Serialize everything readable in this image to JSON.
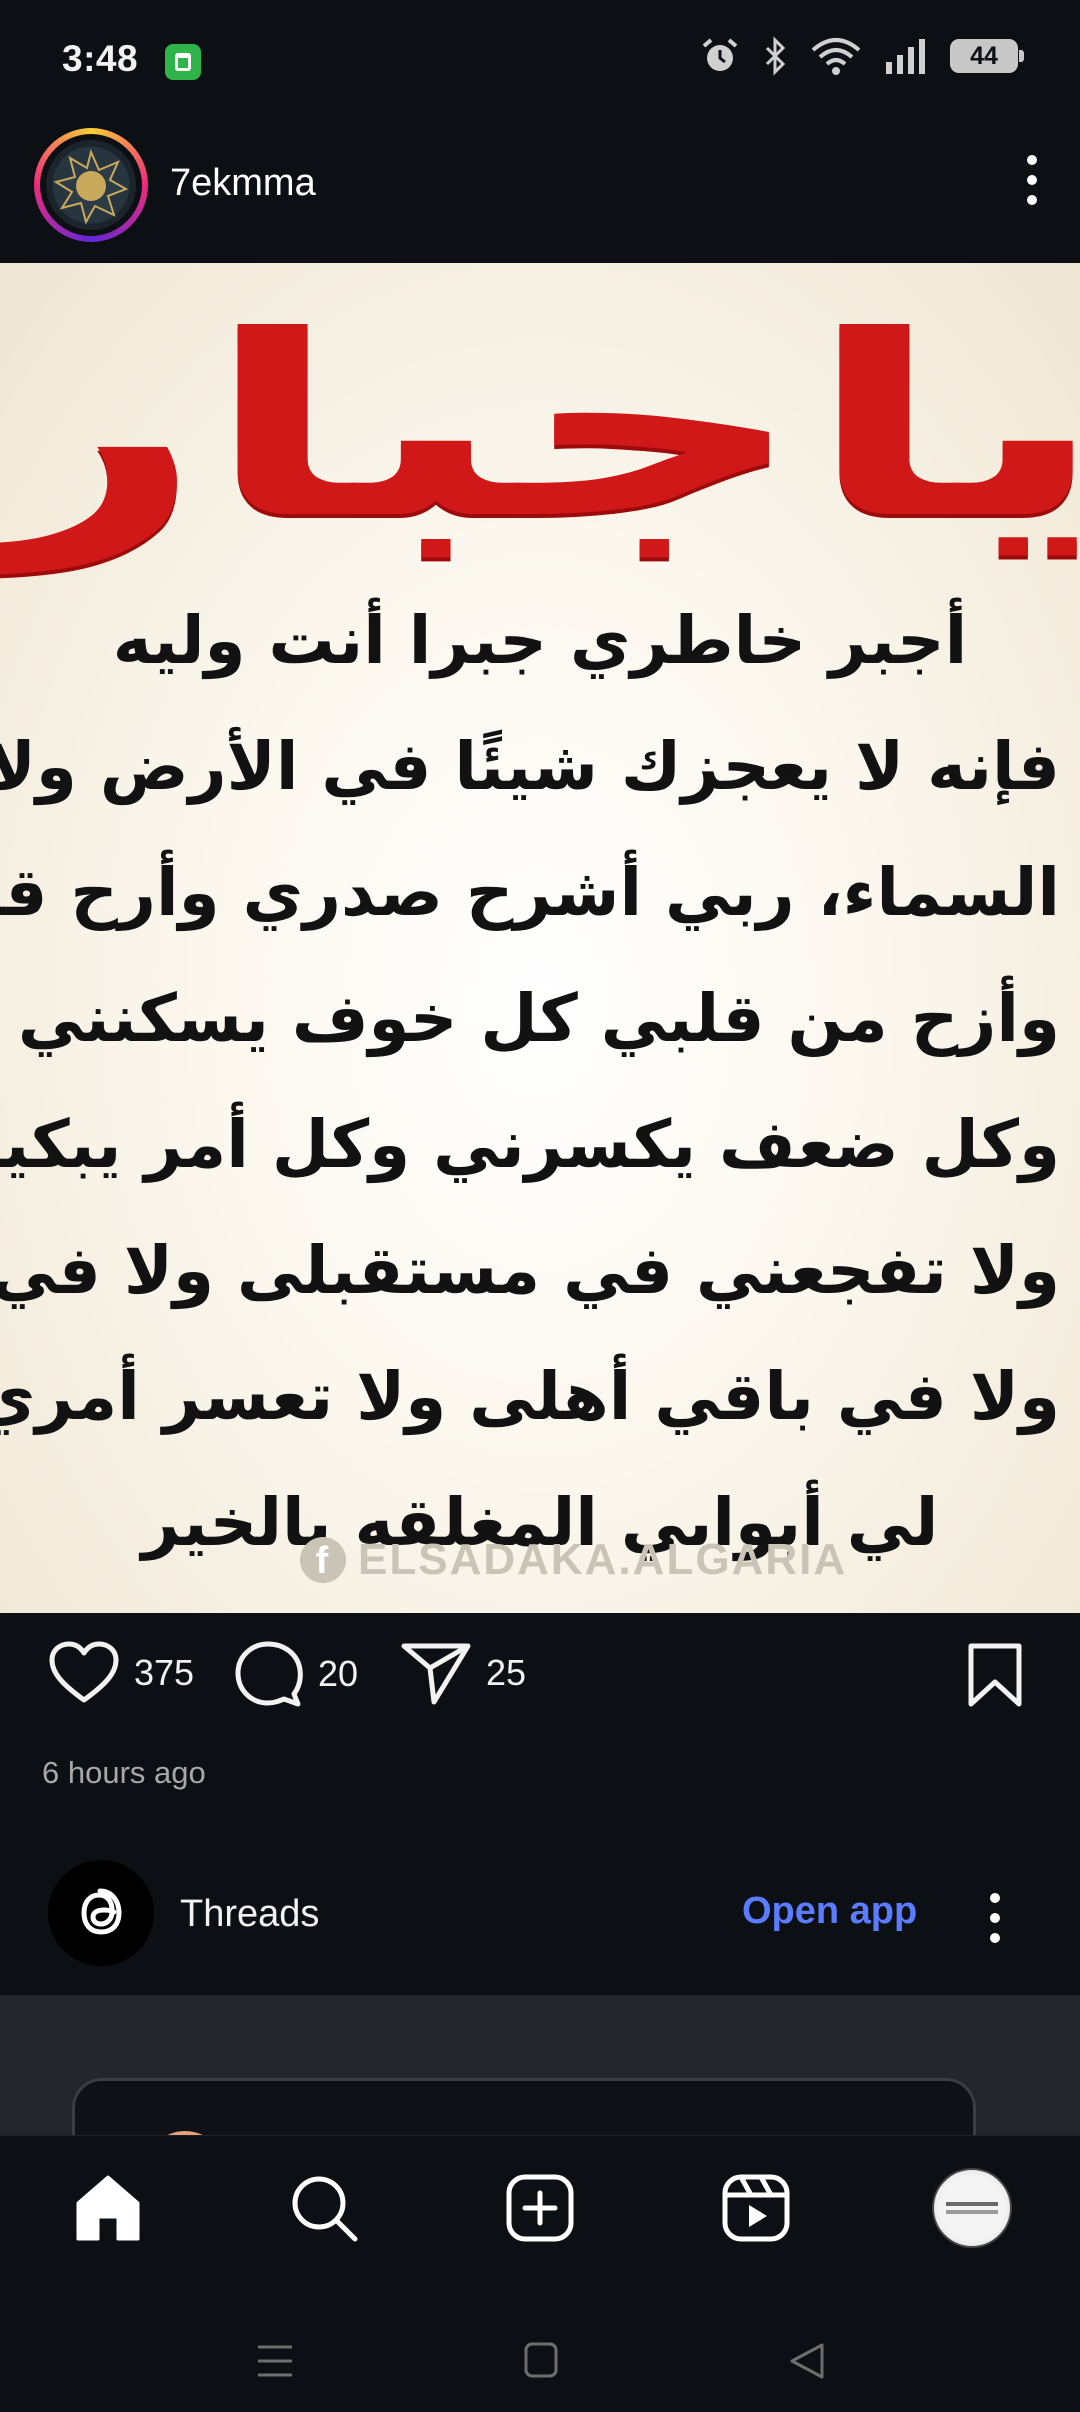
{
  "status_bar": {
    "time": "3:48",
    "battery": "44",
    "icons": [
      "alarm-icon",
      "bluetooth-icon",
      "wifi-icon",
      "signal-icon",
      "battery-icon"
    ]
  },
  "post": {
    "username": "7ekmma",
    "image": {
      "title": "ياجبار",
      "lines": [
        "أجبر خاطري جبرا أنت وليه",
        "فإنه لا يعجزك شيئًا في الأرض ولا في",
        "السماء، ربي أشرح صدري وأرح قلبي",
        "وأزح من قلبي كل خوف يسكنني",
        "وكل ضعف يكسرني وكل أمر يبكيني",
        "ولا تفجعني في مستقبلى ولا في نفسي",
        "ولا في باقي أهلى ولا تعسر أمري وأفتح",
        "لي أبوابي المغلقه بالخير"
      ],
      "watermark": "ELSADAKA.ALGARIA"
    },
    "likes": "375",
    "comments": "20",
    "shares": "25",
    "timestamp": "6 hours ago"
  },
  "threads_banner": {
    "name": "Threads",
    "open_app_label": "Open app"
  },
  "bottom_nav": {
    "items": [
      "home-icon",
      "search-icon",
      "create-icon",
      "reels-icon",
      "profile-avatar"
    ]
  },
  "colors": {
    "background": "#0c0f14",
    "accent_link": "#5b7cff",
    "title_red": "#d01818"
  }
}
